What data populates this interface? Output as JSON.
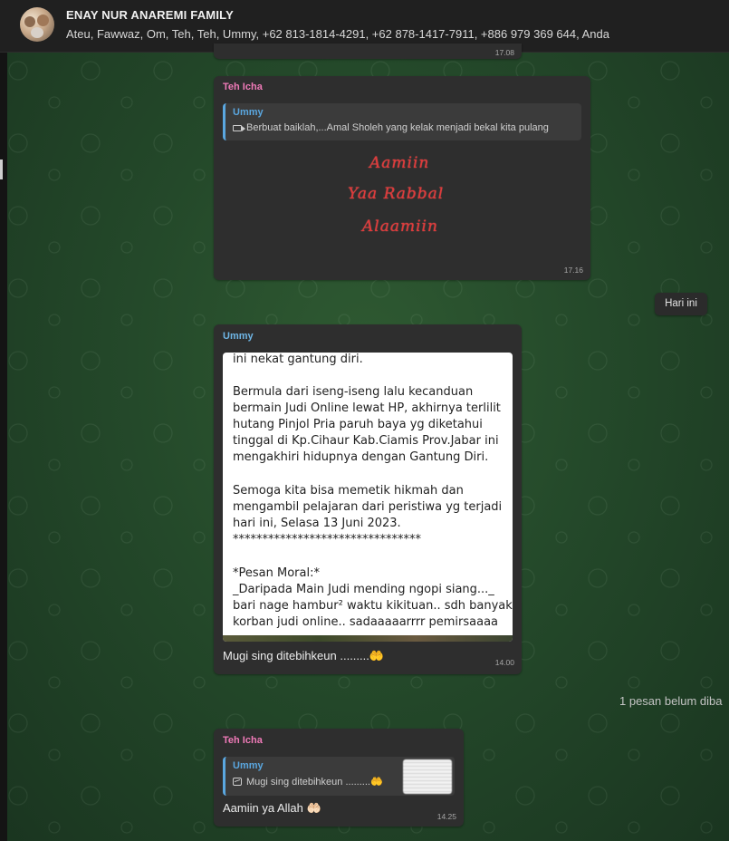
{
  "header": {
    "title": "ENAY NUR ANAREMI FAMILY",
    "members": "Ateu, Fawwaz, Om, Teh, Teh, Ummy, +62 813-1814-4291, +62 878-1417-7911, +886 979 369 644, Anda"
  },
  "messages": {
    "top_partial_time": "17.08",
    "sticker_msg": {
      "sender": "Teh Icha",
      "quote_sender": "Ummy",
      "quote_text": "Berbuat baiklah,...Amal Sholeh yang kelak menjadi bekal kita pulang",
      "sticker_lines": [
        "Aamiin",
        "Yaa Rabbal",
        "Alaamiin"
      ],
      "time": "17.16"
    },
    "date_chip": "Hari ini",
    "image_msg": {
      "sender": "Ummy",
      "screenshot_lines": [
        "ini nekat gantung diri.",
        "",
        "Bermula dari iseng-iseng lalu kecanduan",
        "bermain Judi Online lewat HP, akhirnya terlilit",
        "hutang Pinjol Pria paruh baya yg diketahui",
        "tinggal di Kp.Cihaur Kab.Ciamis Prov.Jabar ini",
        "mengakhiri hidupnya dengan Gantung Diri.",
        "",
        "Semoga kita bisa memetik hikmah dan",
        "mengambil pelajaran dari peristiwa yg terjadi",
        "hari ini, Selasa 13 Juni 2023.",
        "********************************",
        "",
        "*Pesan Moral:*",
        "_Daripada Main Judi mending ngopi siang..._",
        "bari nage hambur² waktu kikituan.. sdh banyak",
        "korban judi online.. sadaaaaarrrr pemirsaaaa"
      ],
      "caption": "Mugi sing ditebihkeun .........🤲",
      "time": "14.00"
    },
    "unread_banner": "1 pesan belum diba",
    "reply_msg": {
      "sender": "Teh Icha",
      "quote_sender": "Ummy",
      "quote_text": "Mugi sing ditebihkeun .........🤲",
      "text": "Aamiin ya Allah 🤲🏻",
      "time": "14.25"
    }
  },
  "colors": {
    "sender_pink": "#f07ab8",
    "sender_blue": "#6fb6e6",
    "bubble": "#2e2e2e",
    "background": "#24492a"
  }
}
